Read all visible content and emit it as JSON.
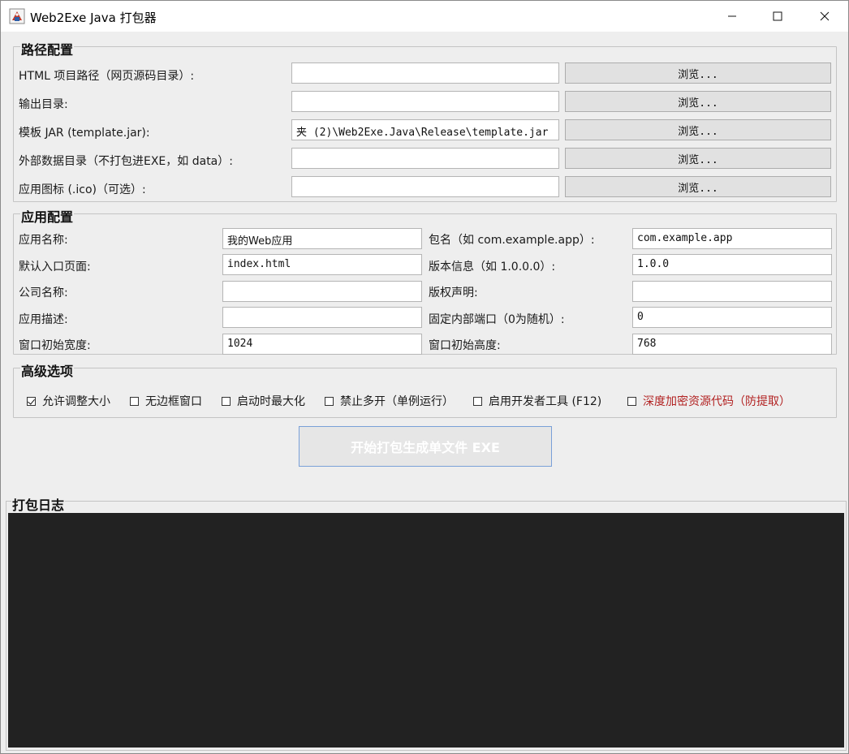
{
  "window": {
    "title": "Web2Exe Java 打包器"
  },
  "path_config": {
    "title": "路径配置",
    "rows": [
      {
        "label": "HTML 项目路径（网页源码目录）:",
        "value": "",
        "button": "浏览..."
      },
      {
        "label": "输出目录:",
        "value": "",
        "button": "浏览..."
      },
      {
        "label": "模板 JAR (template.jar):",
        "value": "夹 (2)\\Web2Exe.Java\\Release\\template.jar",
        "button": "浏览..."
      },
      {
        "label": "外部数据目录（不打包进EXE，如 data）:",
        "value": "",
        "button": "浏览..."
      },
      {
        "label": "应用图标 (.ico)（可选）:",
        "value": "",
        "button": "浏览..."
      }
    ]
  },
  "app_config": {
    "title": "应用配置",
    "rows": [
      {
        "left_label": "应用名称:",
        "left_value": "我的Web应用",
        "right_label": "包名（如 com.example.app）:",
        "right_value": "com.example.app"
      },
      {
        "left_label": "默认入口页面:",
        "left_value": "index.html",
        "right_label": "版本信息（如 1.0.0.0）:",
        "right_value": "1.0.0"
      },
      {
        "left_label": "公司名称:",
        "left_value": "",
        "right_label": "版权声明:",
        "right_value": ""
      },
      {
        "left_label": "应用描述:",
        "left_value": "",
        "right_label": "固定内部端口（0为随机）:",
        "right_value": "0"
      },
      {
        "left_label": "窗口初始宽度:",
        "left_value": "1024",
        "right_label": "窗口初始高度:",
        "right_value": "768"
      }
    ]
  },
  "advanced": {
    "title": "高级选项",
    "options": [
      {
        "label": "允许调整大小",
        "checked": true
      },
      {
        "label": "无边框窗口",
        "checked": false
      },
      {
        "label": "启动时最大化",
        "checked": false
      },
      {
        "label": "禁止多开（单例运行）",
        "checked": false
      },
      {
        "label": "启用开发者工具 (F12)",
        "checked": false
      },
      {
        "label": "深度加密资源代码（防提取）",
        "checked": false
      }
    ],
    "danger_color": "#b22222"
  },
  "build": {
    "label": "开始打包生成单文件 EXE"
  },
  "log": {
    "title": "打包日志",
    "content": "",
    "background": "#222222"
  }
}
